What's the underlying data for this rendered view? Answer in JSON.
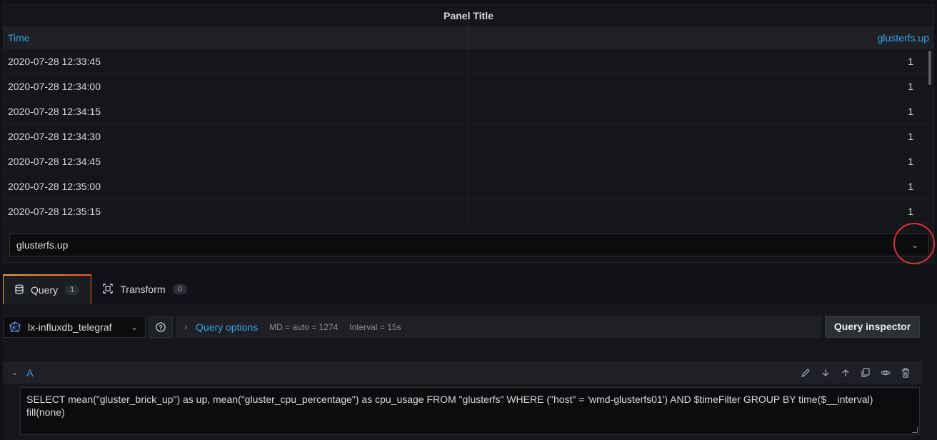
{
  "panel": {
    "title": "Panel Title",
    "columns": {
      "time": "Time",
      "value": "glusterfs.up"
    },
    "rows": [
      {
        "time": "2020-07-28 12:33:45",
        "value": "1"
      },
      {
        "time": "2020-07-28 12:34:00",
        "value": "1"
      },
      {
        "time": "2020-07-28 12:34:15",
        "value": "1"
      },
      {
        "time": "2020-07-28 12:34:30",
        "value": "1"
      },
      {
        "time": "2020-07-28 12:34:45",
        "value": "1"
      },
      {
        "time": "2020-07-28 12:35:00",
        "value": "1"
      },
      {
        "time": "2020-07-28 12:35:15",
        "value": "1"
      }
    ],
    "series_select": "glusterfs.up"
  },
  "tabs": {
    "query": {
      "label": "Query",
      "count": "1"
    },
    "transform": {
      "label": "Transform",
      "count": "0"
    }
  },
  "query_row": {
    "datasource": "lx-influxdb_telegraf",
    "options_label": "Query options",
    "md": "MD = auto = 1274",
    "interval": "Interval = 15s",
    "inspector_label": "Query inspector"
  },
  "query_a": {
    "ref": "A",
    "text": "SELECT mean(\"gluster_brick_up\") as up, mean(\"gluster_cpu_percentage\") as cpu_usage FROM \"glusterfs\" WHERE (\"host\" = 'wmd-glusterfs01') AND $timeFilter GROUP BY time($__interval) fill(none)"
  },
  "colors": {
    "accent": "#33a2e5",
    "highlight_circle": "#e02f2f",
    "background": "#111217"
  }
}
